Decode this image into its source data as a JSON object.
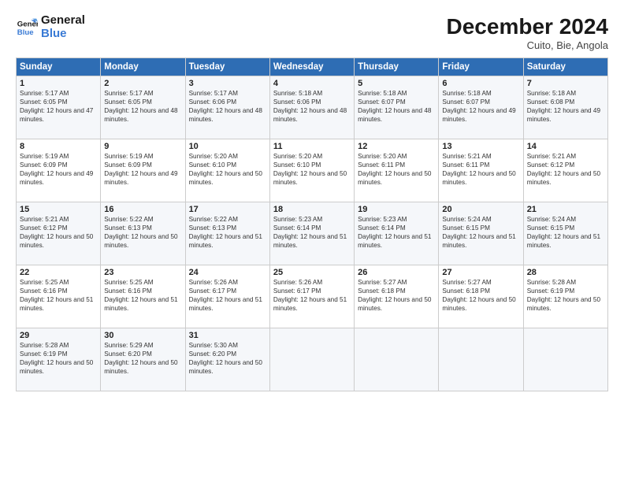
{
  "logo": {
    "line1": "General",
    "line2": "Blue"
  },
  "title": "December 2024",
  "subtitle": "Cuito, Bie, Angola",
  "weekdays": [
    "Sunday",
    "Monday",
    "Tuesday",
    "Wednesday",
    "Thursday",
    "Friday",
    "Saturday"
  ],
  "weeks": [
    [
      {
        "day": "1",
        "sunrise": "Sunrise: 5:17 AM",
        "sunset": "Sunset: 6:05 PM",
        "daylight": "Daylight: 12 hours and 47 minutes."
      },
      {
        "day": "2",
        "sunrise": "Sunrise: 5:17 AM",
        "sunset": "Sunset: 6:05 PM",
        "daylight": "Daylight: 12 hours and 48 minutes."
      },
      {
        "day": "3",
        "sunrise": "Sunrise: 5:17 AM",
        "sunset": "Sunset: 6:06 PM",
        "daylight": "Daylight: 12 hours and 48 minutes."
      },
      {
        "day": "4",
        "sunrise": "Sunrise: 5:18 AM",
        "sunset": "Sunset: 6:06 PM",
        "daylight": "Daylight: 12 hours and 48 minutes."
      },
      {
        "day": "5",
        "sunrise": "Sunrise: 5:18 AM",
        "sunset": "Sunset: 6:07 PM",
        "daylight": "Daylight: 12 hours and 48 minutes."
      },
      {
        "day": "6",
        "sunrise": "Sunrise: 5:18 AM",
        "sunset": "Sunset: 6:07 PM",
        "daylight": "Daylight: 12 hours and 49 minutes."
      },
      {
        "day": "7",
        "sunrise": "Sunrise: 5:18 AM",
        "sunset": "Sunset: 6:08 PM",
        "daylight": "Daylight: 12 hours and 49 minutes."
      }
    ],
    [
      {
        "day": "8",
        "sunrise": "Sunrise: 5:19 AM",
        "sunset": "Sunset: 6:09 PM",
        "daylight": "Daylight: 12 hours and 49 minutes."
      },
      {
        "day": "9",
        "sunrise": "Sunrise: 5:19 AM",
        "sunset": "Sunset: 6:09 PM",
        "daylight": "Daylight: 12 hours and 49 minutes."
      },
      {
        "day": "10",
        "sunrise": "Sunrise: 5:20 AM",
        "sunset": "Sunset: 6:10 PM",
        "daylight": "Daylight: 12 hours and 50 minutes."
      },
      {
        "day": "11",
        "sunrise": "Sunrise: 5:20 AM",
        "sunset": "Sunset: 6:10 PM",
        "daylight": "Daylight: 12 hours and 50 minutes."
      },
      {
        "day": "12",
        "sunrise": "Sunrise: 5:20 AM",
        "sunset": "Sunset: 6:11 PM",
        "daylight": "Daylight: 12 hours and 50 minutes."
      },
      {
        "day": "13",
        "sunrise": "Sunrise: 5:21 AM",
        "sunset": "Sunset: 6:11 PM",
        "daylight": "Daylight: 12 hours and 50 minutes."
      },
      {
        "day": "14",
        "sunrise": "Sunrise: 5:21 AM",
        "sunset": "Sunset: 6:12 PM",
        "daylight": "Daylight: 12 hours and 50 minutes."
      }
    ],
    [
      {
        "day": "15",
        "sunrise": "Sunrise: 5:21 AM",
        "sunset": "Sunset: 6:12 PM",
        "daylight": "Daylight: 12 hours and 50 minutes."
      },
      {
        "day": "16",
        "sunrise": "Sunrise: 5:22 AM",
        "sunset": "Sunset: 6:13 PM",
        "daylight": "Daylight: 12 hours and 50 minutes."
      },
      {
        "day": "17",
        "sunrise": "Sunrise: 5:22 AM",
        "sunset": "Sunset: 6:13 PM",
        "daylight": "Daylight: 12 hours and 51 minutes."
      },
      {
        "day": "18",
        "sunrise": "Sunrise: 5:23 AM",
        "sunset": "Sunset: 6:14 PM",
        "daylight": "Daylight: 12 hours and 51 minutes."
      },
      {
        "day": "19",
        "sunrise": "Sunrise: 5:23 AM",
        "sunset": "Sunset: 6:14 PM",
        "daylight": "Daylight: 12 hours and 51 minutes."
      },
      {
        "day": "20",
        "sunrise": "Sunrise: 5:24 AM",
        "sunset": "Sunset: 6:15 PM",
        "daylight": "Daylight: 12 hours and 51 minutes."
      },
      {
        "day": "21",
        "sunrise": "Sunrise: 5:24 AM",
        "sunset": "Sunset: 6:15 PM",
        "daylight": "Daylight: 12 hours and 51 minutes."
      }
    ],
    [
      {
        "day": "22",
        "sunrise": "Sunrise: 5:25 AM",
        "sunset": "Sunset: 6:16 PM",
        "daylight": "Daylight: 12 hours and 51 minutes."
      },
      {
        "day": "23",
        "sunrise": "Sunrise: 5:25 AM",
        "sunset": "Sunset: 6:16 PM",
        "daylight": "Daylight: 12 hours and 51 minutes."
      },
      {
        "day": "24",
        "sunrise": "Sunrise: 5:26 AM",
        "sunset": "Sunset: 6:17 PM",
        "daylight": "Daylight: 12 hours and 51 minutes."
      },
      {
        "day": "25",
        "sunrise": "Sunrise: 5:26 AM",
        "sunset": "Sunset: 6:17 PM",
        "daylight": "Daylight: 12 hours and 51 minutes."
      },
      {
        "day": "26",
        "sunrise": "Sunrise: 5:27 AM",
        "sunset": "Sunset: 6:18 PM",
        "daylight": "Daylight: 12 hours and 50 minutes."
      },
      {
        "day": "27",
        "sunrise": "Sunrise: 5:27 AM",
        "sunset": "Sunset: 6:18 PM",
        "daylight": "Daylight: 12 hours and 50 minutes."
      },
      {
        "day": "28",
        "sunrise": "Sunrise: 5:28 AM",
        "sunset": "Sunset: 6:19 PM",
        "daylight": "Daylight: 12 hours and 50 minutes."
      }
    ],
    [
      {
        "day": "29",
        "sunrise": "Sunrise: 5:28 AM",
        "sunset": "Sunset: 6:19 PM",
        "daylight": "Daylight: 12 hours and 50 minutes."
      },
      {
        "day": "30",
        "sunrise": "Sunrise: 5:29 AM",
        "sunset": "Sunset: 6:20 PM",
        "daylight": "Daylight: 12 hours and 50 minutes."
      },
      {
        "day": "31",
        "sunrise": "Sunrise: 5:30 AM",
        "sunset": "Sunset: 6:20 PM",
        "daylight": "Daylight: 12 hours and 50 minutes."
      },
      null,
      null,
      null,
      null
    ]
  ]
}
